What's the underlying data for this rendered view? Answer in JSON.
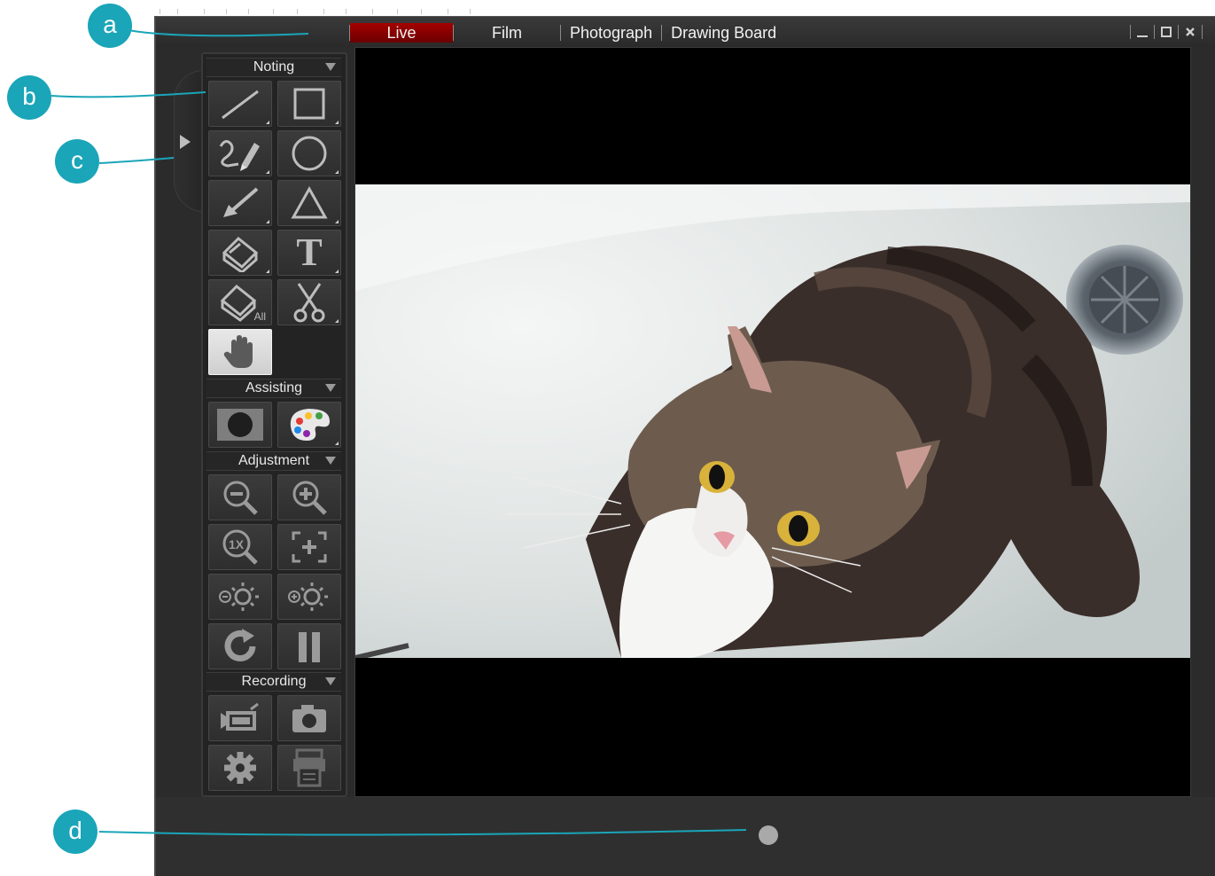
{
  "window": {
    "tabs": [
      {
        "label": "Live",
        "active": true
      },
      {
        "label": "Film",
        "active": false
      },
      {
        "label": "Photograph",
        "active": false
      },
      {
        "label": "Drawing Board",
        "active": false
      }
    ],
    "controls": [
      "minimize-icon",
      "maximize-icon",
      "close-icon"
    ],
    "accent_color": "#8b0000"
  },
  "toolbox": {
    "sections": [
      {
        "label": "Noting",
        "tools": [
          "line",
          "rectangle",
          "freehand-pen",
          "circle",
          "arrow",
          "triangle",
          "eraser",
          "text",
          "erase-all",
          "cut",
          "hand-pan"
        ]
      },
      {
        "label": "Assisting",
        "tools": [
          "spotlight",
          "color-palette"
        ]
      },
      {
        "label": "Adjustment",
        "tools": [
          "zoom-out",
          "zoom-in",
          "zoom-1x",
          "fit-to-window",
          "brightness-down",
          "brightness-up",
          "rotate",
          "pause"
        ]
      },
      {
        "label": "Recording",
        "tools": [
          "video-record",
          "camera-capture",
          "settings",
          "print"
        ]
      }
    ],
    "erase_all_label": "All",
    "zoom_1x_label": "1X",
    "text_tool_glyph": "T",
    "selected_tool": "hand-pan"
  },
  "callouts": [
    {
      "label": "a"
    },
    {
      "label": "b"
    },
    {
      "label": "c"
    },
    {
      "label": "d"
    }
  ],
  "callout_color": "#1aa5b8"
}
